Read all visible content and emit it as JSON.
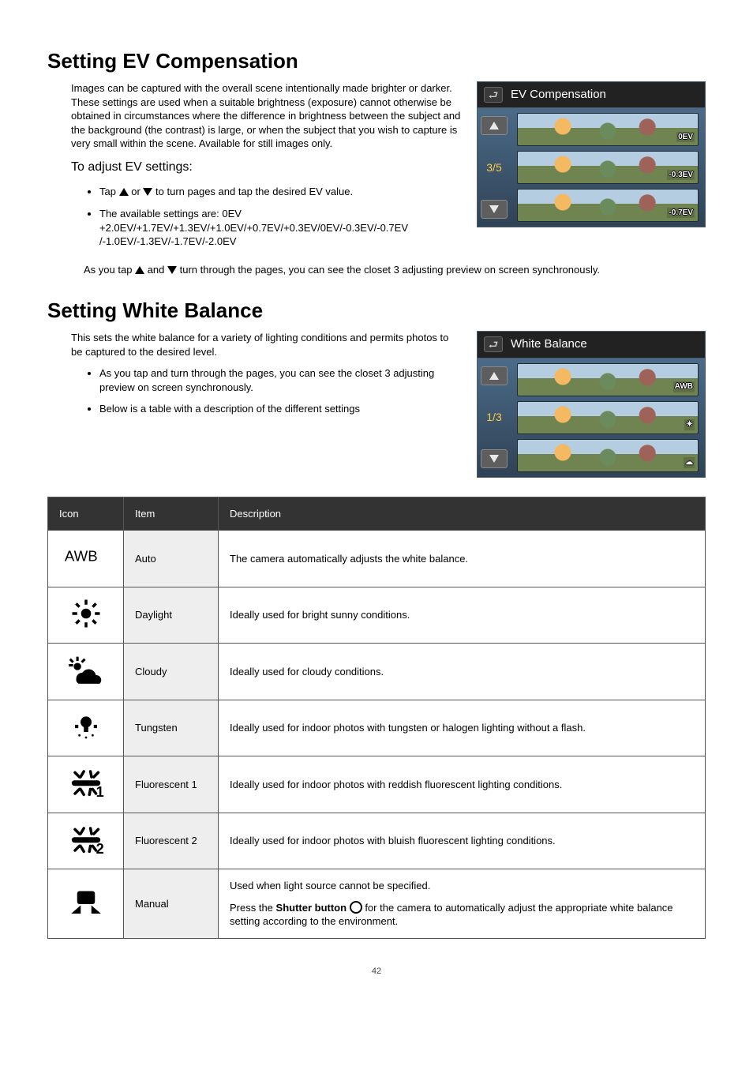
{
  "page_number": "42",
  "sections": {
    "ev": {
      "heading": "Setting EV Compensation",
      "intro": "Images can be captured with the overall scene intentionally made brighter or darker.  These settings are used when a suitable brightness (exposure) cannot otherwise be obtained in circumstances where the difference in brightness between the subject and the background (the contrast) is large, or when the subject that you wish to capture is very small within the scene.  Available for still images only.",
      "subhead": "To adjust EV settings:",
      "bullets": [
        "to turn pages and tap the desired EV value.",
        "The available settings are: 0EV +2.0EV/+1.7EV/+1.3EV/+1.0EV/+0.7EV/+0.3EV/0EV/-0.3EV/-0.7EV /-1.0EV/-1.3EV/-1.7EV/-2.0EV"
      ],
      "bullet1_prefix": "Tap",
      "bullet1_or": "or",
      "note_prefix": "As you tap",
      "note_mid": "and",
      "note_suffix": "turn through the pages, you can see the closet 3 adjusting preview on screen synchronously.",
      "ui": {
        "title": "EV Compensation",
        "page": "3/5",
        "badges": [
          "0EV",
          "-0.3EV",
          "-0.7EV"
        ]
      }
    },
    "wb": {
      "heading": "Setting White Balance",
      "intro": "This sets the white balance for a variety of lighting conditions and permits photos to be captured to the desired level.",
      "bullets": [
        "As you tap and turn through the pages, you can see the closet 3 adjusting preview on screen synchronously.",
        "Below is a table with a description of the different settings"
      ],
      "ui": {
        "title": "White Balance",
        "page": "1/3",
        "badges": [
          "AWB",
          "☀",
          "☁"
        ]
      }
    }
  },
  "table": {
    "headers": [
      "Icon",
      "Item",
      "Description"
    ],
    "rows": [
      {
        "item": "Auto",
        "desc": "The camera automatically adjusts the white balance."
      },
      {
        "item": "Daylight",
        "desc": "Ideally used for bright sunny conditions."
      },
      {
        "item": "Cloudy",
        "desc": "Ideally used for cloudy conditions."
      },
      {
        "item": "Tungsten",
        "desc": "Ideally used for indoor photos with tungsten or halogen lighting without a flash."
      },
      {
        "item": "Fluorescent 1",
        "desc": "Ideally used for indoor photos with reddish fluorescent lighting conditions."
      },
      {
        "item": "Fluorescent 2",
        "desc": "Ideally used for indoor photos with bluish fluorescent lighting conditions."
      },
      {
        "item": "Manual",
        "desc_line1": "Used when light source cannot be specified.",
        "desc_line2a": "Press the ",
        "desc_bold": "Shutter button",
        "desc_line2b": " for the camera to automatically adjust the appropriate white balance setting according to the environment."
      }
    ]
  }
}
